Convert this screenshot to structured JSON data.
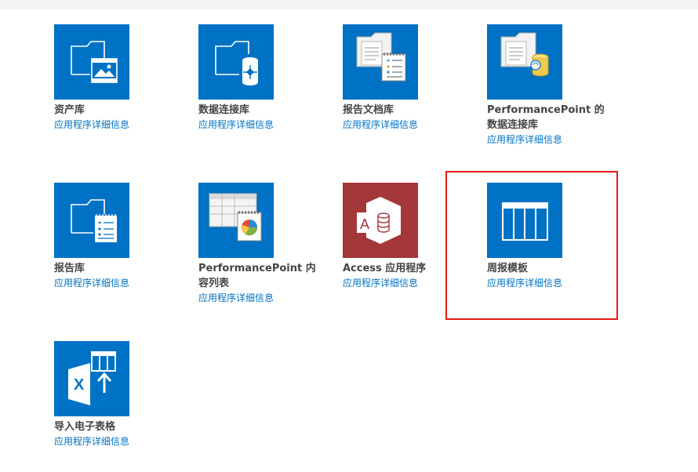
{
  "apps": [
    {
      "name": "资产库",
      "details": "应用程序详细信息",
      "icon": "asset-library-icon"
    },
    {
      "name": "数据连接库",
      "details": "应用程序详细信息",
      "icon": "data-connection-library-icon"
    },
    {
      "name": "报告文档库",
      "details": "应用程序详细信息",
      "icon": "report-document-library-icon"
    },
    {
      "name": "PerformancePoint 的数据连接库",
      "details": "应用程序详细信息",
      "icon": "performancepoint-data-connection-icon"
    },
    {
      "name": "报告库",
      "details": "应用程序详细信息",
      "icon": "report-library-icon"
    },
    {
      "name": "PerformancePoint 内容列表",
      "details": "应用程序详细信息",
      "icon": "performancepoint-content-list-icon"
    },
    {
      "name": "Access 应用程序",
      "details": "应用程序详细信息",
      "icon": "access-app-icon"
    },
    {
      "name": "周报模板",
      "details": "应用程序详细信息",
      "icon": "custom-list-icon"
    },
    {
      "name": "导入电子表格",
      "details": "应用程序详细信息",
      "icon": "import-spreadsheet-icon"
    }
  ],
  "colors": {
    "tile_blue": "#0072c6",
    "access_red": "#a4373a",
    "link_blue": "#0072c6",
    "highlight_red": "#e41b17"
  }
}
